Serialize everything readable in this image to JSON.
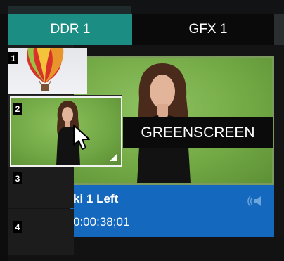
{
  "tabs": [
    {
      "label": "DDR 1",
      "active": true
    },
    {
      "label": "GFX 1",
      "active": false
    }
  ],
  "slots": [
    {
      "number": "1",
      "thumbnail": "hot-air-balloon"
    },
    {
      "number": "2",
      "thumbnail": "greenscreen-presenter",
      "selected": true
    },
    {
      "number": "3"
    },
    {
      "number": "4"
    }
  ],
  "tooltip": "GREENSCREEN",
  "clip": {
    "name": "ki 1 Left",
    "timecode": "0:00:38;01"
  },
  "icons": {
    "audio": "speaker-icon",
    "cursor": "mouse-pointer-icon",
    "play_marker": "play-triangle-icon"
  },
  "colors": {
    "tab_active": "#1b8d83",
    "info_bar": "#1468bd",
    "greenscreen": "#74aa46"
  }
}
